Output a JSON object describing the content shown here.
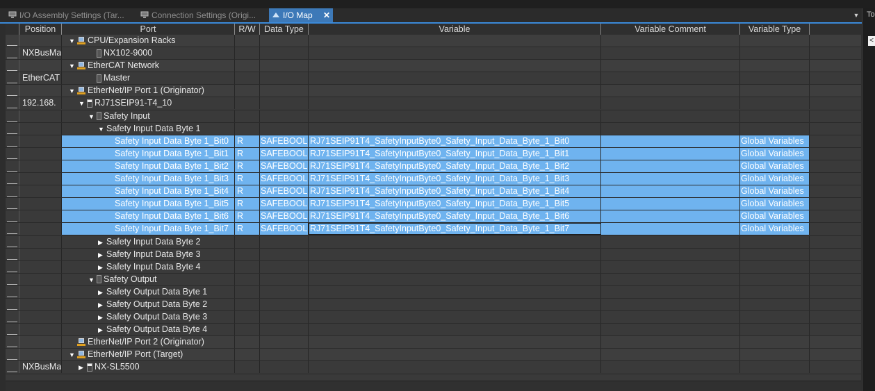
{
  "tabs": [
    {
      "label": "I/O Assembly Settings (Tar...",
      "active": false
    },
    {
      "label": "Connection Settings (Origi...",
      "active": false
    },
    {
      "label": "I/O Map",
      "active": true
    }
  ],
  "right_panel_label": "To",
  "right_panel_button": "<",
  "columns": {
    "position": "Position",
    "port": "Port",
    "rw": "R/W",
    "data_type": "Data Type",
    "variable": "Variable",
    "variable_comment": "Variable Comment",
    "variable_type": "Variable Type"
  },
  "rows": [
    {
      "pos": "",
      "port": "CPU/Expansion Racks",
      "indent": 0,
      "expander": "▼",
      "icon": "network-icon",
      "group": true
    },
    {
      "pos": "NXBusMa",
      "port": "NX102-9000",
      "indent": 2,
      "expander": "",
      "icon": "device-icon"
    },
    {
      "pos": "",
      "port": "EtherCAT Network",
      "indent": 0,
      "expander": "▼",
      "icon": "network-icon",
      "group": true
    },
    {
      "pos": "EtherCAT",
      "port": "Master",
      "indent": 2,
      "expander": "",
      "icon": "device-icon"
    },
    {
      "pos": "",
      "port": "EtherNet/IP Port 1 (Originator)",
      "indent": 0,
      "expander": "▼",
      "icon": "network-icon",
      "group": true
    },
    {
      "pos": "192.168.",
      "port": "RJ71SEIP91-T4_10",
      "indent": 1,
      "expander": "▼",
      "icon": "device-icon-2"
    },
    {
      "pos": "",
      "port": "Safety Input",
      "indent": 2,
      "expander": "▼",
      "icon": "device-icon"
    },
    {
      "pos": "",
      "port": "Safety Input Data Byte 1",
      "indent": 3,
      "expander": "▼",
      "icon": ""
    },
    {
      "pos": "",
      "port": "Safety Input Data Byte 1_Bit0",
      "indent": 5,
      "expander": "",
      "icon": "",
      "sel": true,
      "rw": "R",
      "dtype": "SAFEBOOL",
      "var": "RJ71SEIP91T4_SafetyInputByte0_Safety_Input_Data_Byte_1_Bit0",
      "vtype": "Global Variables"
    },
    {
      "pos": "",
      "port": "Safety Input Data Byte 1_Bit1",
      "indent": 5,
      "expander": "",
      "icon": "",
      "sel": true,
      "rw": "R",
      "dtype": "SAFEBOOL",
      "var": "RJ71SEIP91T4_SafetyInputByte0_Safety_Input_Data_Byte_1_Bit1",
      "vtype": "Global Variables"
    },
    {
      "pos": "",
      "port": "Safety Input Data Byte 1_Bit2",
      "indent": 5,
      "expander": "",
      "icon": "",
      "sel": true,
      "rw": "R",
      "dtype": "SAFEBOOL",
      "var": "RJ71SEIP91T4_SafetyInputByte0_Safety_Input_Data_Byte_1_Bit2",
      "vtype": "Global Variables"
    },
    {
      "pos": "",
      "port": "Safety Input Data Byte 1_Bit3",
      "indent": 5,
      "expander": "",
      "icon": "",
      "sel": true,
      "rw": "R",
      "dtype": "SAFEBOOL",
      "var": "RJ71SEIP91T4_SafetyInputByte0_Safety_Input_Data_Byte_1_Bit3",
      "vtype": "Global Variables"
    },
    {
      "pos": "",
      "port": "Safety Input Data Byte 1_Bit4",
      "indent": 5,
      "expander": "",
      "icon": "",
      "sel": true,
      "rw": "R",
      "dtype": "SAFEBOOL",
      "var": "RJ71SEIP91T4_SafetyInputByte0_Safety_Input_Data_Byte_1_Bit4",
      "vtype": "Global Variables"
    },
    {
      "pos": "",
      "port": "Safety Input Data Byte 1_Bit5",
      "indent": 5,
      "expander": "",
      "icon": "",
      "sel": true,
      "rw": "R",
      "dtype": "SAFEBOOL",
      "var": "RJ71SEIP91T4_SafetyInputByte0_Safety_Input_Data_Byte_1_Bit5",
      "vtype": "Global Variables"
    },
    {
      "pos": "",
      "port": "Safety Input Data Byte 1_Bit6",
      "indent": 5,
      "expander": "",
      "icon": "",
      "sel": true,
      "rw": "R",
      "dtype": "SAFEBOOL",
      "var": "RJ71SEIP91T4_SafetyInputByte0_Safety_Input_Data_Byte_1_Bit6",
      "vtype": "Global Variables"
    },
    {
      "pos": "",
      "port": "Safety Input Data Byte 1_Bit7",
      "indent": 5,
      "expander": "",
      "icon": "",
      "sel": true,
      "focus": true,
      "rw": "R",
      "dtype": "SAFEBOOL",
      "var": "RJ71SEIP91T4_SafetyInputByte0_Safety_Input_Data_Byte_1_Bit7",
      "vtype": "Global Variables"
    },
    {
      "pos": "",
      "port": "Safety Input Data Byte 2",
      "indent": 3,
      "expander": "▶",
      "icon": ""
    },
    {
      "pos": "",
      "port": "Safety Input Data Byte 3",
      "indent": 3,
      "expander": "▶",
      "icon": ""
    },
    {
      "pos": "",
      "port": "Safety Input Data Byte 4",
      "indent": 3,
      "expander": "▶",
      "icon": ""
    },
    {
      "pos": "",
      "port": "Safety Output",
      "indent": 2,
      "expander": "▼",
      "icon": "device-icon"
    },
    {
      "pos": "",
      "port": "Safety Output Data Byte 1",
      "indent": 3,
      "expander": "▶",
      "icon": ""
    },
    {
      "pos": "",
      "port": "Safety Output Data Byte 2",
      "indent": 3,
      "expander": "▶",
      "icon": ""
    },
    {
      "pos": "",
      "port": "Safety Output Data Byte 3",
      "indent": 3,
      "expander": "▶",
      "icon": ""
    },
    {
      "pos": "",
      "port": "Safety Output Data Byte 4",
      "indent": 3,
      "expander": "▶",
      "icon": ""
    },
    {
      "pos": "",
      "port": "EtherNet/IP Port 2 (Originator)",
      "indent": 0,
      "expander": "",
      "icon": "network-icon",
      "group": true
    },
    {
      "pos": "",
      "port": "EtherNet/IP Port (Target)",
      "indent": 0,
      "expander": "▼",
      "icon": "network-icon",
      "group": true
    },
    {
      "pos": "NXBusMa",
      "port": "NX-SL5500",
      "indent": 1,
      "expander": "▶",
      "icon": "device-icon-2"
    }
  ]
}
